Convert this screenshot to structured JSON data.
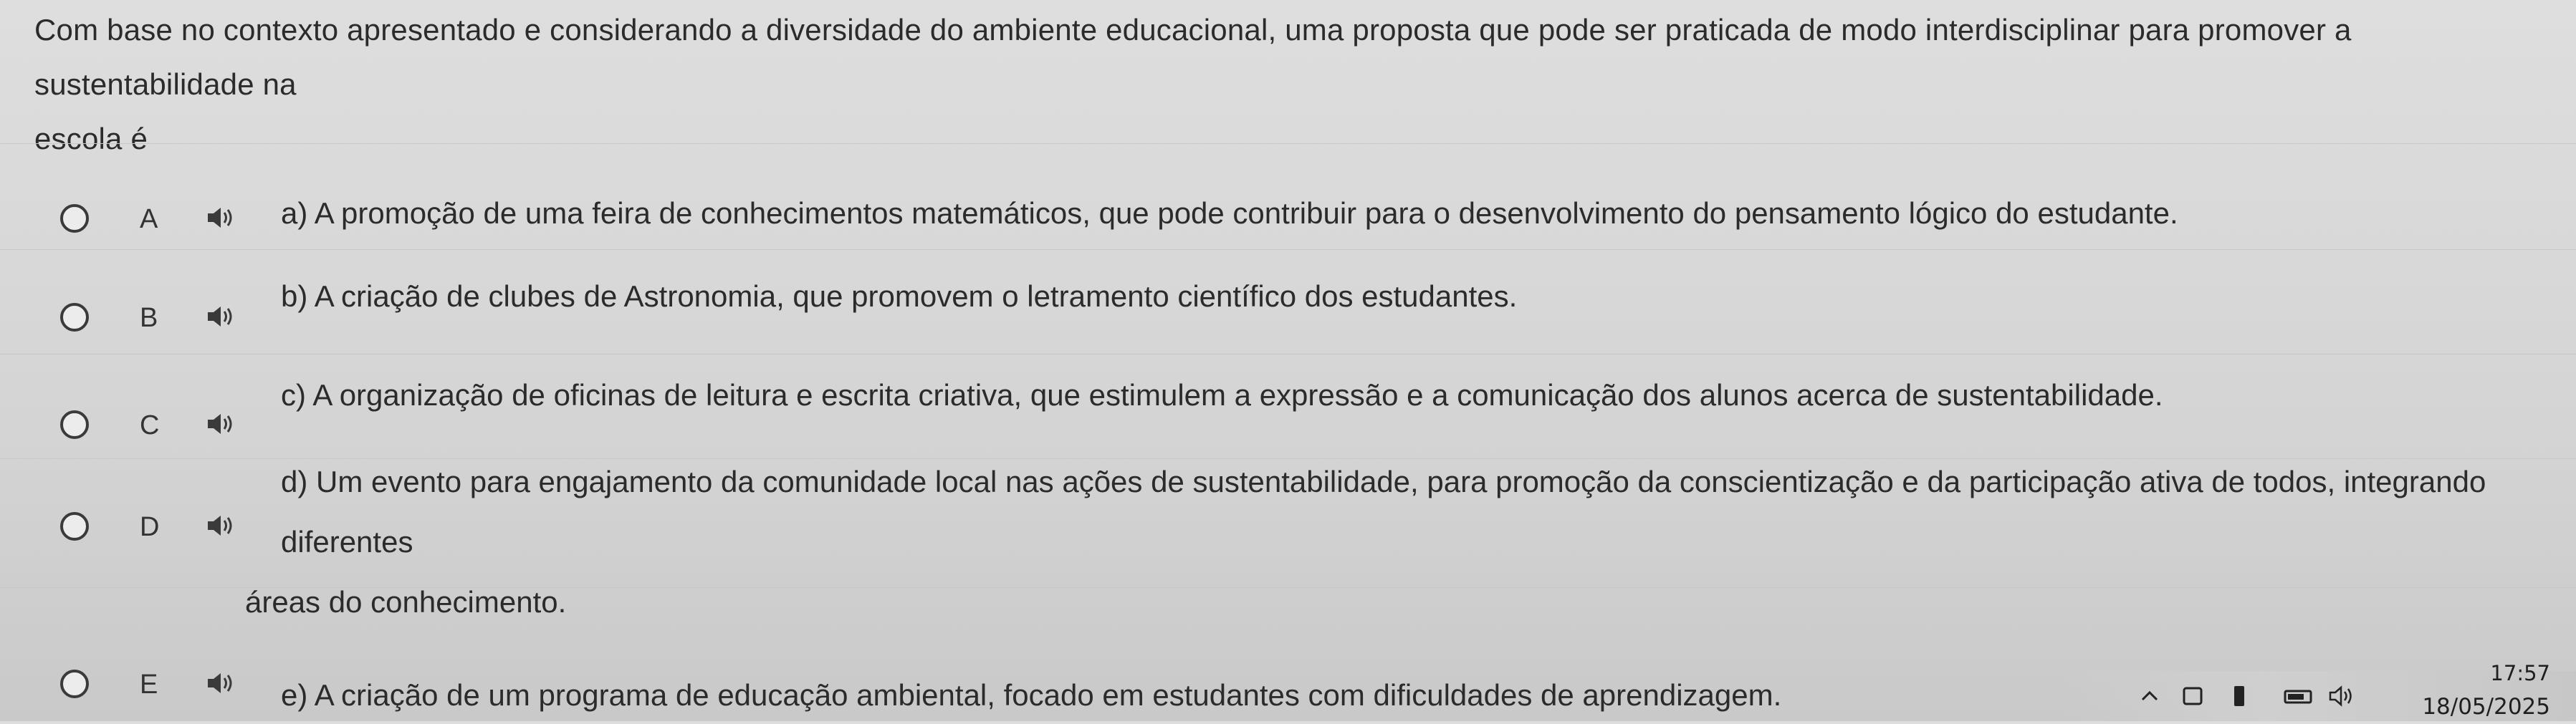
{
  "question": {
    "line1": "Com base no contexto apresentado e considerando a diversidade do ambiente educacional, uma proposta que pode ser praticada de modo interdisciplinar para promover a sustentabilidade na",
    "line2": "escola é"
  },
  "options": [
    {
      "letter": "A",
      "line1": "a) A promoção de uma feira de conhecimentos matemáticos, que pode contribuir para o desenvolvimento do pensamento lógico do estudante.",
      "line2": ""
    },
    {
      "letter": "B",
      "line1": "b) A criação de clubes de Astronomia, que promovem o letramento científico dos estudantes.",
      "line2": ""
    },
    {
      "letter": "C",
      "line1": "c) A organização de oficinas de leitura e escrita criativa, que estimulem a expressão e a comunicação dos alunos acerca de sustentabilidade.",
      "line2": ""
    },
    {
      "letter": "D",
      "line1": "d) Um evento para engajamento da comunidade local nas ações de sustentabilidade, para promoção da conscientização e da participação ativa de todos, integrando diferentes",
      "line2": "áreas do conhecimento."
    },
    {
      "letter": "E",
      "line1": "e) A criação de um programa de educação ambiental, focado em estudantes com dificuldades de aprendizagem.",
      "line2": ""
    }
  ],
  "icons": {
    "option_audio": "speaker-icon",
    "radio": "radio-circle"
  },
  "taskbar": {
    "time": "17:57",
    "date": "18/05/2025"
  }
}
